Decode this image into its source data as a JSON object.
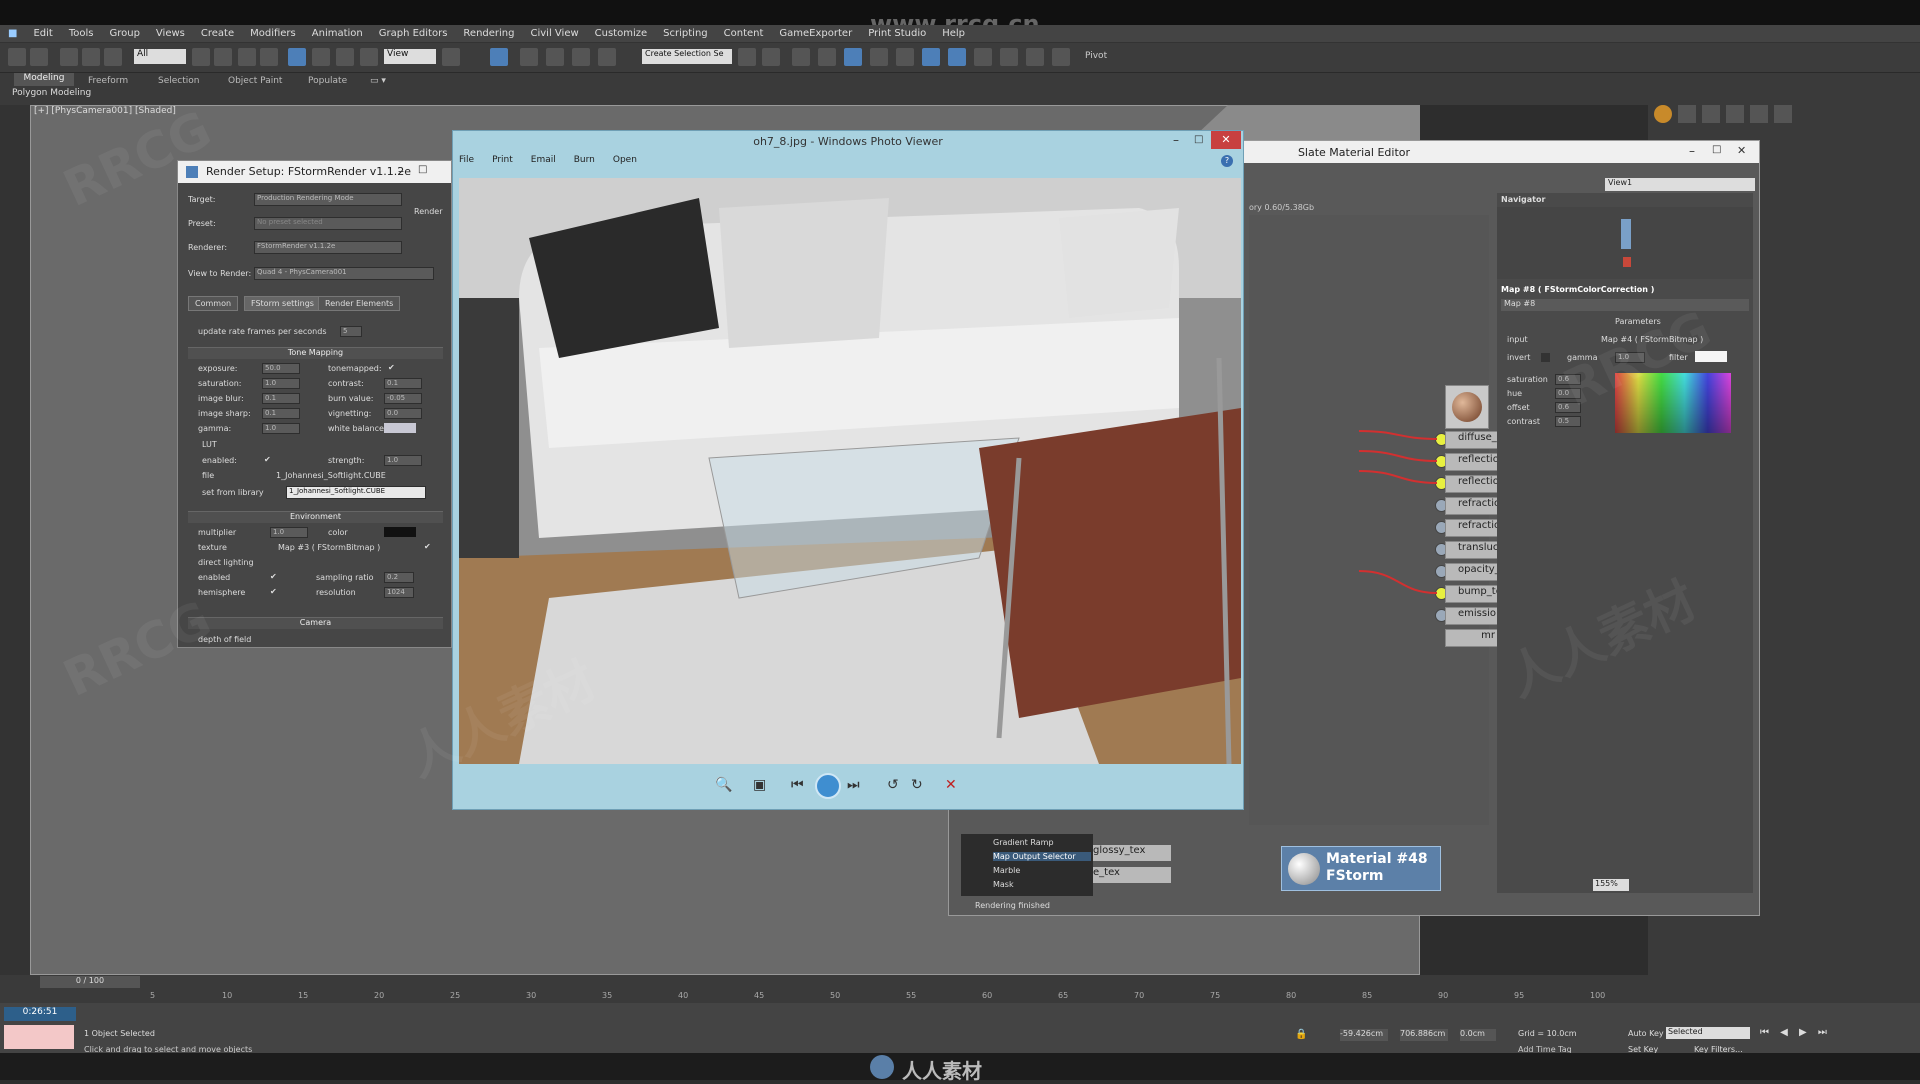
{
  "watermark_top": "www.rrcg.cn",
  "watermark_text": "RRCG",
  "watermark_cn": "人人素材",
  "menu": [
    "Edit",
    "Tools",
    "Group",
    "Views",
    "Create",
    "Modifiers",
    "Animation",
    "Graph Editors",
    "Rendering",
    "Civil View",
    "Customize",
    "Scripting",
    "Content",
    "GameExporter",
    "Print Studio",
    "Help"
  ],
  "toolbar": {
    "selection_filter": "All",
    "ref_coord": "View",
    "named_sel": "Create Selection Se",
    "pivot": "Pivot"
  },
  "ribbon": {
    "tabs": [
      "Modeling",
      "Freeform",
      "Selection",
      "Object Paint",
      "Populate"
    ],
    "sub": "Polygon Modeling"
  },
  "viewport_label": "[+] [PhysCamera001] [Shaded]",
  "render_setup": {
    "title": "Render Setup: FStormRender v1.1.2e",
    "target_label": "Target:",
    "target": "Production Rendering Mode",
    "preset_label": "Preset:",
    "preset": "No preset selected",
    "renderer_label": "Renderer:",
    "renderer": "FStormRender v1.1.2e",
    "view_label": "View to Render:",
    "view": "Quad 4 - PhysCamera001",
    "render_btn": "Render",
    "tabs": [
      "Common",
      "FStorm settings",
      "Render Elements"
    ],
    "update_rate": "update rate frames per seconds",
    "update_val": "5",
    "tone_mapping": "Tone Mapping",
    "exposure": "exposure:",
    "exposure_v": "50.0",
    "tonemapped": "tonemapped:",
    "saturation": "saturation:",
    "saturation_v": "1.0",
    "contrast": "contrast:",
    "contrast_v": "0.1",
    "image_blur": "image blur:",
    "image_blur_v": "0.1",
    "burn_value": "burn value:",
    "burn_value_v": "-0.05",
    "image_sharp": "image sharp:",
    "image_sharp_v": "0.1",
    "vignetting": "vignetting:",
    "vignetting_v": "0.0",
    "gamma": "gamma:",
    "gamma_v": "1.0",
    "white_balance": "white balance:",
    "lut": "LUT",
    "enabled": "enabled:",
    "strength": "strength:",
    "strength_v": "1.0",
    "file": "file",
    "file_v": "1_Johannesi_Softlight.CUBE",
    "set_from_library": "set from library",
    "library_v": "1_Johannesi_Softlight.CUBE",
    "environment": "Environment",
    "multiplier": "multiplier",
    "multiplier_v": "1.0",
    "color": "color",
    "texture": "texture",
    "texture_v": "Map #3 ( FStormBitmap )",
    "direct_lighting": "direct lighting",
    "dl_enabled": "enabled",
    "sampling_ratio": "sampling ratio",
    "sampling_ratio_v": "0.2",
    "hemisphere": "hemisphere",
    "resolution": "resolution",
    "resolution_v": "1024",
    "camera": "Camera",
    "depth_of_field": "depth of field"
  },
  "photo_viewer": {
    "title": "oh7_8.jpg - Windows Photo Viewer",
    "menu": [
      "File",
      "Print",
      "Email",
      "Burn",
      "Open"
    ]
  },
  "slate": {
    "title": "Slate Material Editor",
    "view_sel": "View1",
    "memory": "ory 0.60/5.38Gb",
    "navigator": "Navigator",
    "map_header": "Map #8 ( FStormColorCorrection )",
    "map_name": "Map #8",
    "parameters": "Parameters",
    "input": "input",
    "input_v": "Map #4 ( FStormBitmap )",
    "invert": "invert",
    "gamma": "gamma",
    "gamma_v": "1.0",
    "filter": "filter",
    "saturation": "saturation",
    "saturation_v": "0.6",
    "hue": "hue",
    "hue_v": "0.0",
    "offset": "offset",
    "offset_v": "0.6",
    "contrast": "contrast",
    "contrast_v": "0.5",
    "slots": [
      "diffuse_",
      "reflectio",
      "reflectio",
      "refractio",
      "refractio",
      "transluc",
      "opacity_",
      "bump_te",
      "emissio",
      "mr"
    ],
    "browser": [
      "Gradient Ramp",
      "Map Output Selector",
      "Marble",
      "Mask"
    ],
    "node_texts": [
      "glossy_tex",
      "e_tex"
    ],
    "material": "Material #48",
    "material_sub": "FStorm",
    "rendering_finished": "Rendering finished",
    "zoom": "155%"
  },
  "timeline": {
    "frame": "0 / 100",
    "ticks": [
      "5",
      "10",
      "15",
      "20",
      "25",
      "30",
      "35",
      "40",
      "45",
      "50",
      "55",
      "60",
      "65",
      "70",
      "75",
      "80",
      "85",
      "90",
      "95",
      "100"
    ]
  },
  "status": {
    "selected": "1 Object Selected",
    "hint": "Click and drag to select and move objects",
    "time": "0:26:51",
    "x": "-59.426cm",
    "y": "706.886cm",
    "z": "0.0cm",
    "grid": "Grid = 10.0cm",
    "add_time_tag": "Add Time Tag",
    "auto_key": "Auto Key",
    "auto_key_v": "Selected",
    "set_key": "Set Key",
    "key_filters": "Key Filters..."
  },
  "colors": {
    "accent": "#4d7fb8",
    "viewer_bg": "#a9d2e0",
    "socket_active": "#e8f040"
  }
}
